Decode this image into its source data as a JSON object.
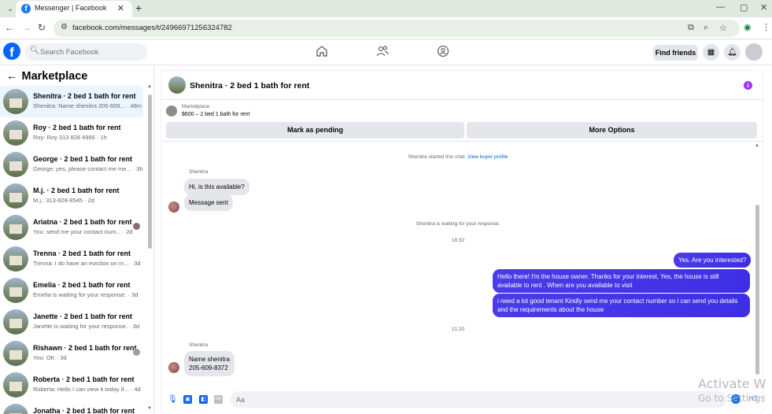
{
  "browser": {
    "tab_title": "Messenger | Facebook",
    "url": "facebook.com/messages/t/24966971256324782",
    "tab_close": "✕",
    "tab_new": "+",
    "window_controls": [
      "—",
      "▢",
      "✕"
    ]
  },
  "fb_nav": {
    "search_placeholder": "Search Facebook",
    "find_friends_label": "Find friends"
  },
  "marketplace": {
    "title": "Marketplace",
    "conversations": [
      {
        "title": "Shenitra · 2 bed 1 bath for rent",
        "subtitle": "Shenitra: Name shenitra 205-609... · 48m"
      },
      {
        "title": "Roy · 2 bed 1 bath for rent",
        "subtitle": "Roy: Roy 313 828 4966 · 1h"
      },
      {
        "title": "George · 2 bed 1 bath for rent",
        "subtitle": "George: yes, please contact me me... · 3h"
      },
      {
        "title": "M.j. · 2 bed 1 bath for rent",
        "subtitle": "M.j.: 313-828-8545 · 2d"
      },
      {
        "title": "Ariatna · 2 bed 1 bath for rent",
        "subtitle": "You: send me your contact num... · 2d"
      },
      {
        "title": "Trenna · 2 bed 1 bath for rent",
        "subtitle": "Trenna: I do have an eviction on m... · 3d"
      },
      {
        "title": "Emelia · 2 bed 1 bath for rent",
        "subtitle": "Emelia is waiting for your response. · 3d"
      },
      {
        "title": "Janette · 2 bed 1 bath for rent",
        "subtitle": "Janette is waiting for your response. · 3d"
      },
      {
        "title": "Rishawn · 2 bed 1 bath for rent",
        "subtitle": "You: OK · 3d"
      },
      {
        "title": "Roberta · 2 bed 1 bath for rent",
        "subtitle": "Roberta: Hello I can view it today if... · 4d"
      },
      {
        "title": "Jonatha · 2 bed 1 bath for rent",
        "subtitle": ""
      }
    ]
  },
  "chat": {
    "header_title": "Shenitra · 2 bed 1 bath for rent",
    "listing_kicker": "Marketplace",
    "listing_price": "$600 – 2 bed 1 bath for rent",
    "mark_pending_label": "Mark as pending",
    "more_options_label": "More Options",
    "started_text": "Shenitra started this chat.",
    "buyer_profile_link": "View buyer profile",
    "sender_name": "Shenitra",
    "msg_in_1": "Hi, is this available?",
    "msg_in_2": "Message sent",
    "waiting_text": "Shenitra is waiting for your response.",
    "time_1": "18:32",
    "msg_out_1": "Yes. Are you interested?",
    "msg_out_2": "Hello there! I'm the house owner. Thanks for your interest, Yes, the house is still available to rent . When are you available to visit",
    "msg_out_3": "i need a lot good tenant Kindly send me your contact number so i can send you details and the requirements about the house",
    "time_2": "21:20",
    "sender_name_2": "Shenitra",
    "msg_in_3_line1": "Name shenitra",
    "msg_in_3_line2": "205-609-8372",
    "composer_placeholder": "Aa"
  },
  "watermark": {
    "line1": "Activate W",
    "line2": "Go to Settings"
  },
  "colors": {
    "fb_blue": "#0866ff",
    "outgoing_bubble": "#4a3ce8",
    "incoming_bubble": "#e4e6eb",
    "info_purple": "#a033ff"
  }
}
